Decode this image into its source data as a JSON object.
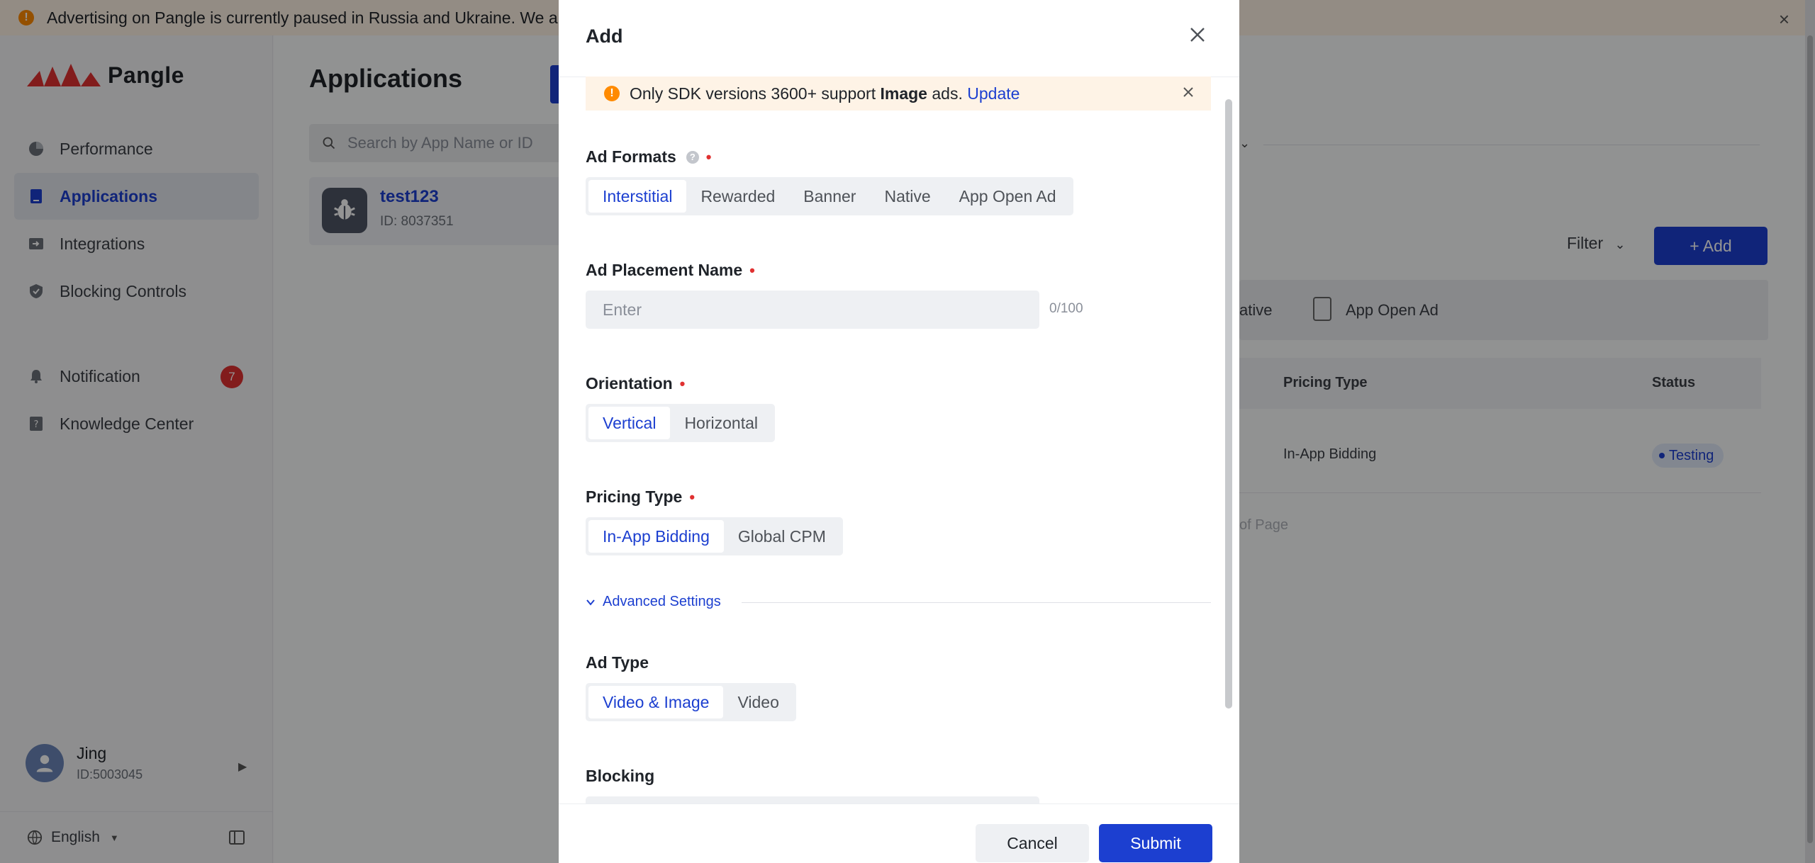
{
  "banner": {
    "text": "Advertising on Pangle is currently paused in Russia and Ukraine. We a",
    "close": "×"
  },
  "sidebar": {
    "brand": "Pangle",
    "items": [
      {
        "label": "Performance",
        "icon": "pie-chart-icon",
        "active": false
      },
      {
        "label": "Applications",
        "icon": "app-icon",
        "active": true
      },
      {
        "label": "Integrations",
        "icon": "integration-icon",
        "active": false
      },
      {
        "label": "Blocking Controls",
        "icon": "shield-icon",
        "active": false
      },
      {
        "label": "Notification",
        "icon": "bell-icon",
        "active": false,
        "badge": "7"
      },
      {
        "label": "Knowledge Center",
        "icon": "help-book-icon",
        "active": false
      }
    ],
    "user": {
      "name": "Jing",
      "id": "ID:5003045"
    },
    "language": "English"
  },
  "main": {
    "title": "Applications",
    "search_placeholder": "Search by App Name or ID",
    "app": {
      "name": "test123",
      "id": "ID: 8037351"
    },
    "filter_label": "Filter",
    "add_label": "+ Add",
    "formats_partial": [
      "ative",
      "App Open Ad"
    ],
    "columns": [
      "Pricing Type",
      "Status"
    ],
    "row": {
      "pricing": "In-App Bidding",
      "status": "Testing"
    },
    "pager_partial": "of Page"
  },
  "modal": {
    "title": "Add",
    "notice": {
      "prefix": "Only SDK versions 3600+ support ",
      "bold": "Image",
      "suffix": " ads. ",
      "link": "Update"
    },
    "ad_formats": {
      "label": "Ad Formats",
      "options": [
        "Interstitial",
        "Rewarded",
        "Banner",
        "Native",
        "App Open Ad"
      ],
      "selected": "Interstitial"
    },
    "placement": {
      "label": "Ad Placement Name",
      "placeholder": "Enter",
      "count": "0/100"
    },
    "orientation": {
      "label": "Orientation",
      "options": [
        "Vertical",
        "Horizontal"
      ],
      "selected": "Vertical"
    },
    "pricing": {
      "label": "Pricing Type",
      "options": [
        "In-App Bidding",
        "Global CPM"
      ],
      "selected": "In-App Bidding"
    },
    "advanced": "Advanced Settings",
    "ad_type": {
      "label": "Ad Type",
      "options": [
        "Video & Image",
        "Video"
      ],
      "selected": "Video & Image"
    },
    "blocking": {
      "label": "Blocking"
    },
    "cancel": "Cancel",
    "submit": "Submit"
  },
  "colors": {
    "primary": "#1c3fd0",
    "warning": "#ff8a00",
    "required": "#e03131",
    "badge": "#e03131"
  }
}
